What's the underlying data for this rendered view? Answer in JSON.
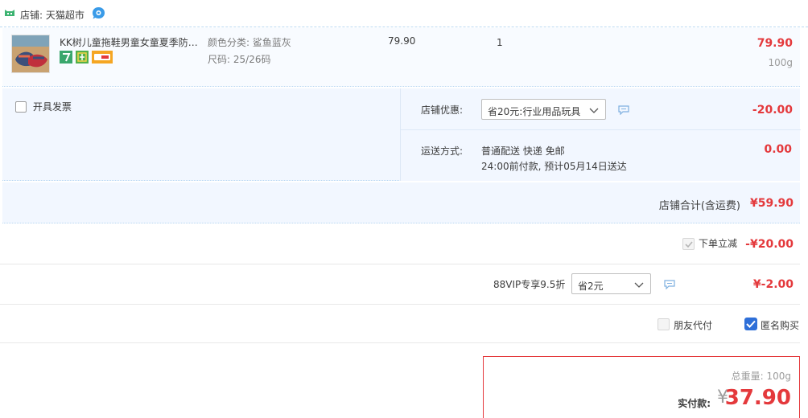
{
  "shop": {
    "label": "店铺: ",
    "name": "天猫超市",
    "logo_icon": "tmall-cat-icon",
    "chat_icon": "aliwangwang-chat-icon"
  },
  "item": {
    "title": "KK树儿童拖鞋男童女童夏季防…",
    "color_label": "颜色分类:",
    "color_value": "鲨鱼蓝灰",
    "size_label": "尺码:",
    "size_value": "25/26码",
    "unit_price": "79.90",
    "quantity": "1",
    "subtotal": "79.90",
    "weight": "100g",
    "badges": [
      "7-day-return-badge",
      "authentic-guarantee-badge",
      "credit-card-badge"
    ]
  },
  "options": {
    "invoice_label": "开具发票",
    "shop_discount_label": "店铺优惠:",
    "shop_discount_selected": "省20元:行业用品玩具",
    "shop_discount_amount": "-20.00",
    "shipping_label": "运送方式:",
    "shipping_method": "普通配送 快递 免邮",
    "shipping_eta": "24:00前付款, 预计05月14日送达",
    "shipping_amount": "0.00"
  },
  "shop_total": {
    "label": "店铺合计(含运费)",
    "value": "¥59.90"
  },
  "instant_discount": {
    "label": "下单立减",
    "value": "-¥20.00",
    "checked": true
  },
  "vip": {
    "label": "88VIP专享9.5折",
    "selected": "省2元",
    "value": "¥-2.00"
  },
  "payment_options": {
    "friend_pay_label": "朋友代付",
    "friend_pay_checked": false,
    "anonymous_label": "匿名购买",
    "anonymous_checked": true
  },
  "summary": {
    "total_weight_label": "总重量: ",
    "total_weight": "100g",
    "pay_label": "实付款:",
    "currency": "¥",
    "pay_value": "37.90"
  },
  "colors": {
    "price_red": "#e4393c",
    "tint_blue": "#f2f7ff",
    "check_blue": "#2e6fd8"
  }
}
